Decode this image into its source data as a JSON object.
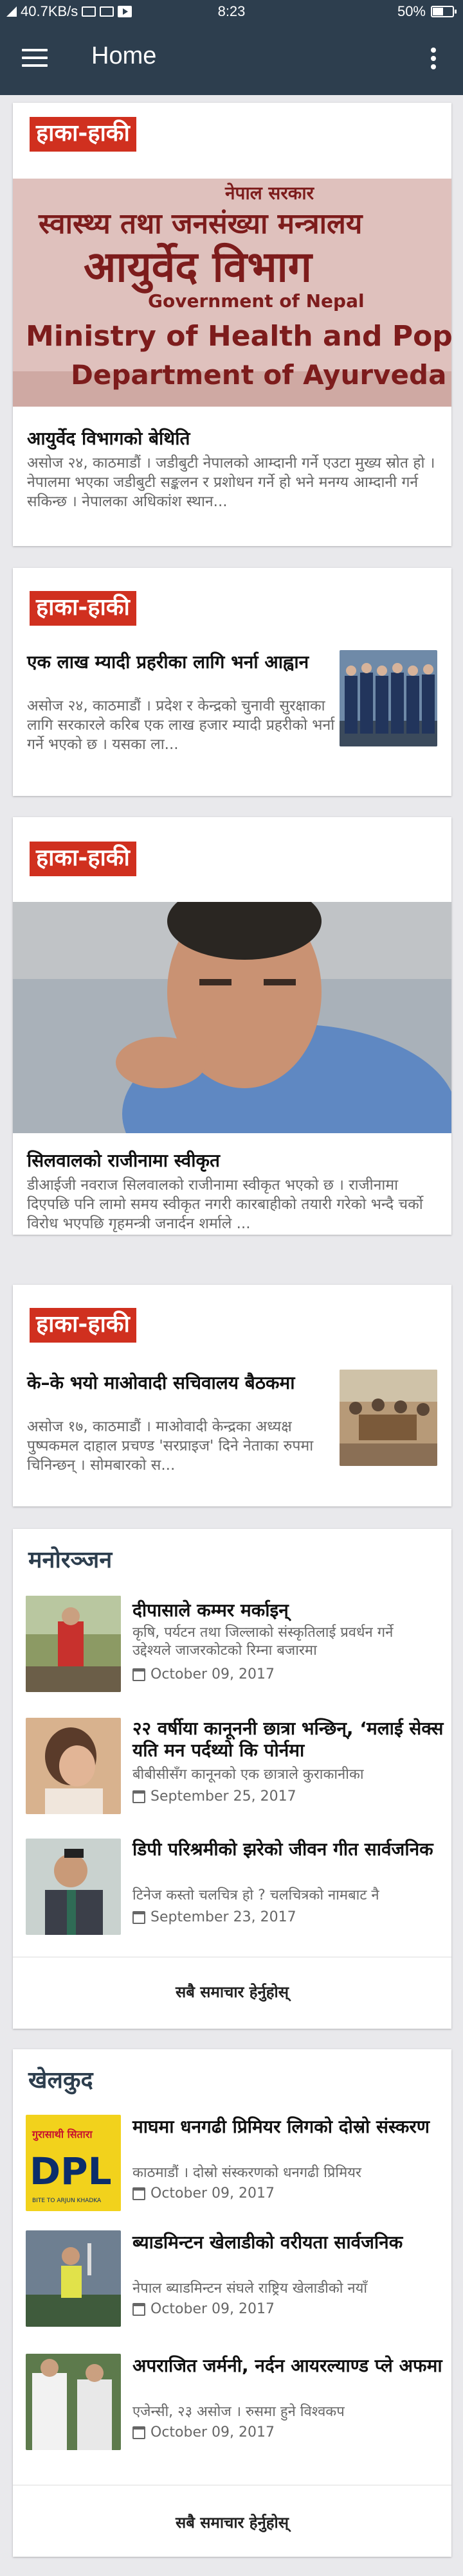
{
  "status_bar": {
    "speed": "40.7KB/s",
    "time": "8:23",
    "battery": "50%"
  },
  "app_bar": {
    "title": "Home"
  },
  "colors": {
    "primary": "#2d3e4e",
    "badge": "#d0301f"
  },
  "cards": [
    {
      "badge": "हाका-हाकी",
      "sign_lines": [
        "नेपाल सरकार",
        "स्वास्थ्य तथा जनसंख्या मन्त्रालय",
        "आयुर्वेद विभाग",
        "Government of Nepal",
        "Ministry of Health and Population",
        "Department of Ayurveda"
      ],
      "title": "आयुर्वेद विभागको बेथिति",
      "excerpt": "असोज २४, काठमाडौं । जडीबुटी नेपालको आम्दानी गर्ने एउटा मुख्य स्रोत हो । नेपालमा भएका जडीबुटी सङ्कलन र प्रशोधन गर्ने हो भने मनग्य आम्दानी गर्न सकिन्छ । नेपालका अधिकांश स्थान..."
    },
    {
      "badge": "हाका-हाकी",
      "title": "एक लाख म्यादी प्रहरीका लागि भर्ना आह्वान",
      "excerpt": "असोज २४, काठमाडौं । प्रदेश र केन्द्रको चुनावी सुरक्षाका लागि सरकारले करिब एक लाख हजार म्यादी प्रहरीको भर्ना गर्ने भएको छ । यसका ला..."
    },
    {
      "badge": "हाका-हाकी",
      "title": "सिलवालको राजीनामा स्वीकृत",
      "excerpt": "डीआईजी नवराज सिलवालको राजीनामा स्वीकृत भएको छ । राजीनामा दिएपछि पनि लामो समय स्वीकृत नगरी कारबाहीको तयारी गरेको भन्दै चर्को विरोध भएपछि गृहमन्त्री जनार्दन शर्माले ..."
    },
    {
      "badge": "हाका-हाकी",
      "title": "के–के भयो माओवादी सचिवालय बैठकमा",
      "excerpt": "असोज १७, काठमाडौं । माओवादी केन्द्रका अध्यक्ष पुष्पकमल दाहाल प्रचण्ड 'सरप्राइज' दिने नेताका रुपमा चिनिन्छन् । सोमबारको स..."
    }
  ],
  "sections": [
    {
      "title": "मनोरञ्जन",
      "more": "सबै समाचार हेर्नुहोस्",
      "items": [
        {
          "title": "दीपासाले कम्मर मर्काइन्",
          "subtitle": "कृषि, पर्यटन तथा जिल्लाको संस्कृतिलाई प्रवर्धन गर्ने उद्देश्यले जाजरकोटको रिम्ना बजारमा",
          "date": "October 09, 2017"
        },
        {
          "title": "२२ वर्षीया कानूननी छात्रा भन्छिन्, ‘मलाई सेक्स यति मन पर्दथ्यो कि पोर्नमा",
          "subtitle": "बीबीसीसँग कानूनको एक छात्राले कुराकानीका",
          "date": "September 25, 2017"
        },
        {
          "title": "डिपी परिश्रमीको झरेको जीवन गीत सार्वजनिक",
          "subtitle": "टिनेज कस्तो चलचित्र हो ? चलचित्रको नामबाट नै",
          "date": "September 23, 2017"
        }
      ]
    },
    {
      "title": "खेलकुद",
      "more": "सबै समाचार हेर्नुहोस्",
      "items": [
        {
          "title": "माघमा धनगढी प्रिमियर लिगको दोस्रो संस्करण",
          "subtitle": "काठमाडौं । दोस्रो संस्करणको धनगढी प्रिमियर",
          "date": "October 09, 2017",
          "logo_text": "DPL",
          "logo_top": "गुरासाथी सितारा",
          "logo_tag": "BITE TO ARJUN KHADKA"
        },
        {
          "title": "ब्याडमिन्टन खेलाडीको वरीयता सार्वजनिक",
          "subtitle": "नेपाल ब्याडमिन्टन संघले राष्ट्रिय खेलाडीको नयाँ",
          "date": "October 09, 2017"
        },
        {
          "title": "अपराजित जर्मनी, नर्दन आयरल्याण्ड प्ले अफमा",
          "subtitle": "एजेन्सी, २३ असोज । रुसमा हुने विश्वकप",
          "date": "October 09, 2017"
        }
      ]
    }
  ]
}
